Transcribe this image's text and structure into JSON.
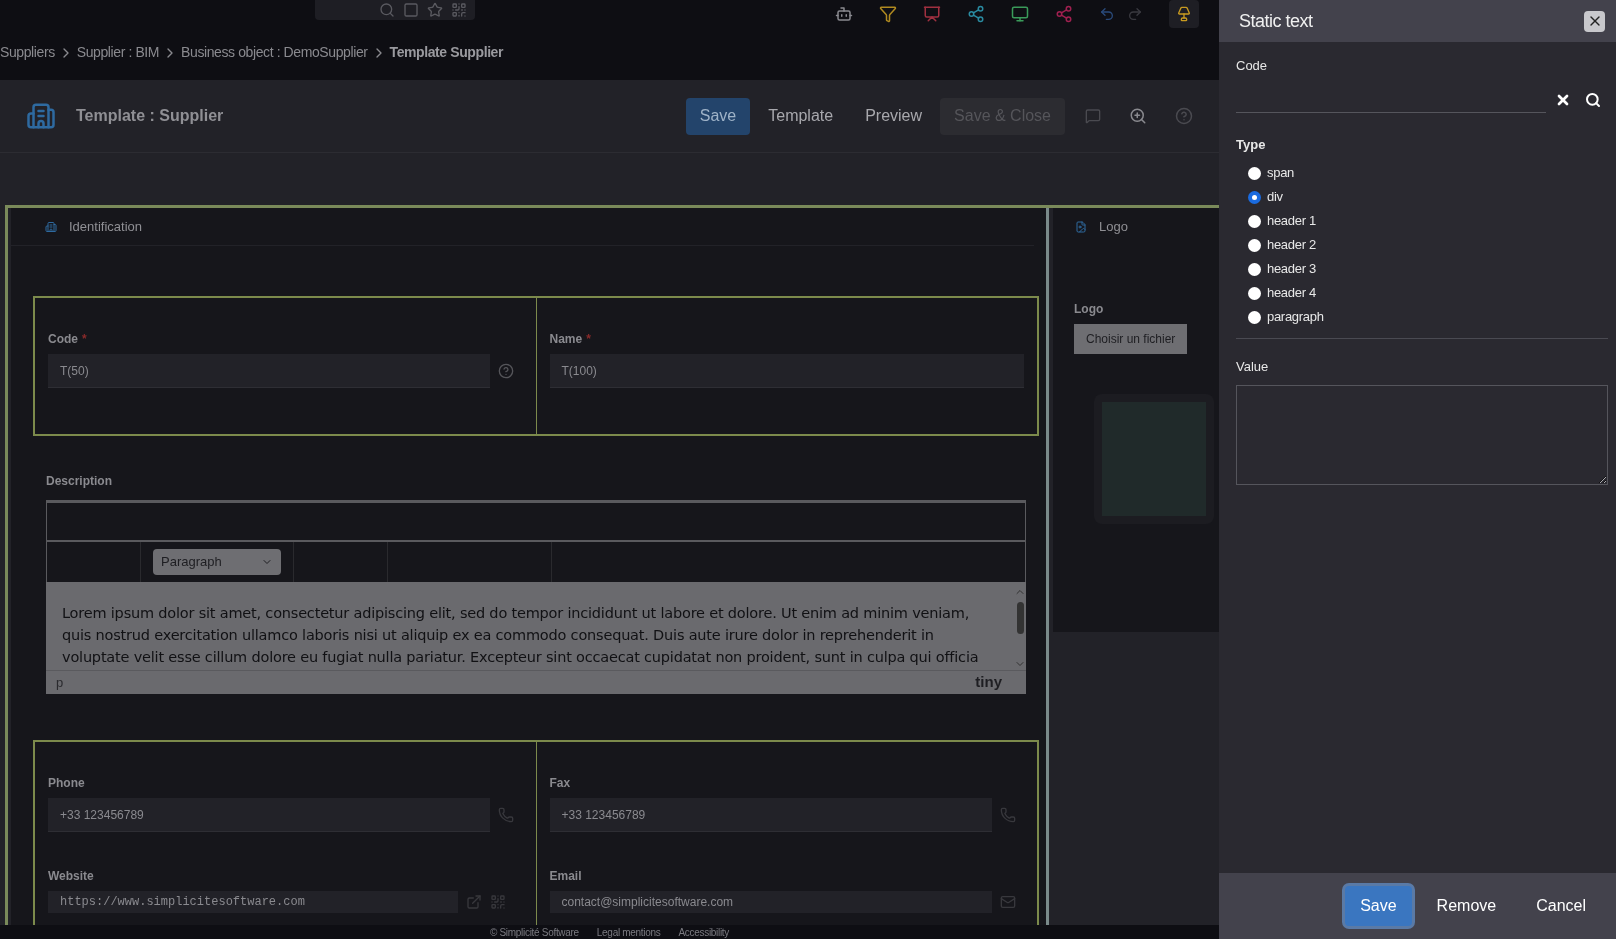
{
  "breadcrumb": [
    {
      "label": "Suppliers",
      "current": false
    },
    {
      "label": "Supplier : BIM",
      "current": false
    },
    {
      "label": "Business object : DemoSupplier",
      "current": false
    },
    {
      "label": "Template Supplier",
      "current": true
    }
  ],
  "header": {
    "title": "Template : Supplier",
    "buttons": [
      {
        "label": "Save",
        "kind": "primary"
      },
      {
        "label": "Template",
        "kind": "plain"
      },
      {
        "label": "Preview",
        "kind": "plain"
      },
      {
        "label": "Save & Close",
        "kind": "disabled"
      }
    ]
  },
  "identification": {
    "title": "Identification",
    "fields": [
      {
        "label": "Code",
        "required_mark": "*",
        "value": "T(50)",
        "kind": "code"
      },
      {
        "label": "Name",
        "required_mark": "*",
        "value": "T(100)",
        "kind": "text"
      }
    ]
  },
  "description": {
    "label": "Description",
    "format": "Paragraph",
    "content": "Lorem ipsum dolor sit amet, consectetur adipiscing elit, sed do tempor incididunt ut labore et dolore. Ut enim ad minim veniam, quis nostrud exercitation ullamco laboris nisi ut aliquip ex ea commodo consequat. Duis aute irure dolor in reprehenderit in voluptate velit esse cillum dolore eu fugiat nulla pariatur. Excepteur sint occaecat cupidatat non proident, sunt in culpa qui officia",
    "path": "p",
    "brand": "tiny"
  },
  "contact": {
    "fields": [
      {
        "label": "Phone",
        "value": "+33 123456789",
        "kind": "phone"
      },
      {
        "label": "Fax",
        "value": "+33 123456789",
        "kind": "phone"
      },
      {
        "label": "Website",
        "value": "https://www.simplicitesoftware.com",
        "kind": "url"
      },
      {
        "label": "Email",
        "value": "contact@simplicitesoftware.com",
        "kind": "email"
      }
    ]
  },
  "logo_panel": {
    "title": "Logo",
    "label": "Logo",
    "button": "Choisir un fichier"
  },
  "footer": [
    "© Simplicité Software",
    "Legal mentions",
    "Accessibility"
  ],
  "dialog": {
    "title": "Static text",
    "code_label": "Code",
    "type_label": "Type",
    "types": [
      {
        "label": "span",
        "selected": false
      },
      {
        "label": "div",
        "selected": true
      },
      {
        "label": "header 1",
        "selected": false
      },
      {
        "label": "header 2",
        "selected": false
      },
      {
        "label": "header 3",
        "selected": false
      },
      {
        "label": "header 4",
        "selected": false
      },
      {
        "label": "paragraph",
        "selected": false
      }
    ],
    "value_label": "Value",
    "buttons": [
      {
        "label": "Save",
        "kind": "primary"
      },
      {
        "label": "Remove",
        "kind": "plain"
      },
      {
        "label": "Cancel",
        "kind": "plain"
      }
    ]
  }
}
